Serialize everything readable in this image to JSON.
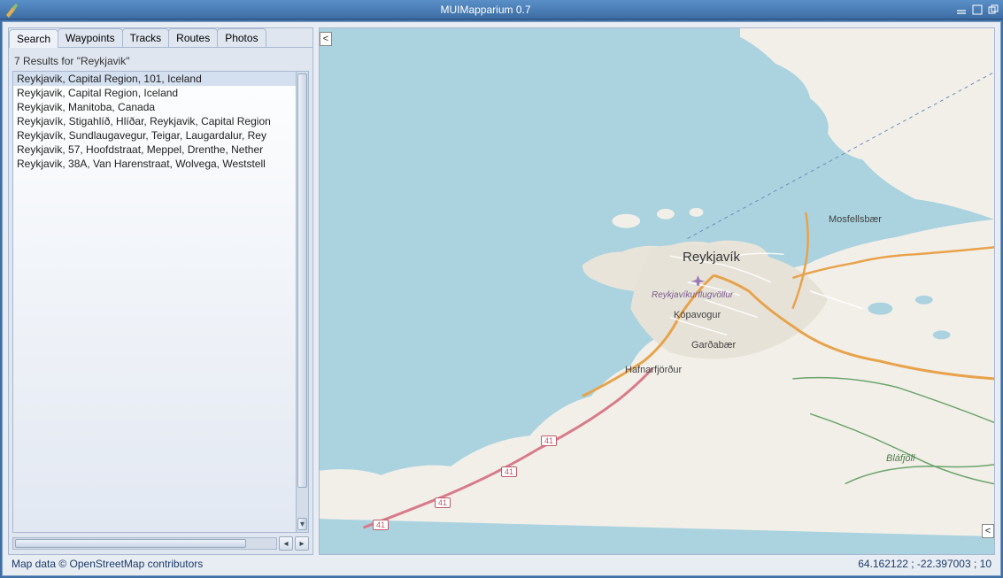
{
  "window": {
    "title": "MUIMapparium 0.7"
  },
  "tabs": [
    {
      "label": "Search",
      "active": true
    },
    {
      "label": "Waypoints",
      "active": false
    },
    {
      "label": "Tracks",
      "active": false
    },
    {
      "label": "Routes",
      "active": false
    },
    {
      "label": "Photos",
      "active": false
    }
  ],
  "search": {
    "header": "7 Results for \"Reykjavik\"",
    "results": [
      "Reykjavik, Capital Region, 101, Iceland",
      "Reykjavik, Capital Region, Iceland",
      "Reykjavik, Manitoba, Canada",
      "Reykjavík, Stigahlíð, Hlíðar, Reykjavik, Capital Region",
      "Reykjavík, Sundlaugavegur, Teigar, Laugardalur, Rey",
      "Reykjavik, 57, Hoofdstraat, Meppel, Drenthe, Nether",
      "Reykjavik, 38A, Van Harenstraat, Wolvega, Weststell"
    ],
    "selected_index": 0
  },
  "map": {
    "collapse_left": "<",
    "collapse_right": "<",
    "labels": {
      "reykjavik": "Reykjavík",
      "mosfellsbaer": "Mosfellsbær",
      "kopavogur": "Kópavogur",
      "gardabaer": "Garðabær",
      "hafnarfjordur": "Hafnarfjörður",
      "airport": "Reykjavíkurflugvöllur",
      "blafjoll": "Bláfjöll"
    },
    "routes": {
      "r41": "41"
    }
  },
  "status": {
    "attribution": "Map data © OpenStreetMap contributors",
    "coords": "64.162122 ; -22.397003 ; 10"
  }
}
